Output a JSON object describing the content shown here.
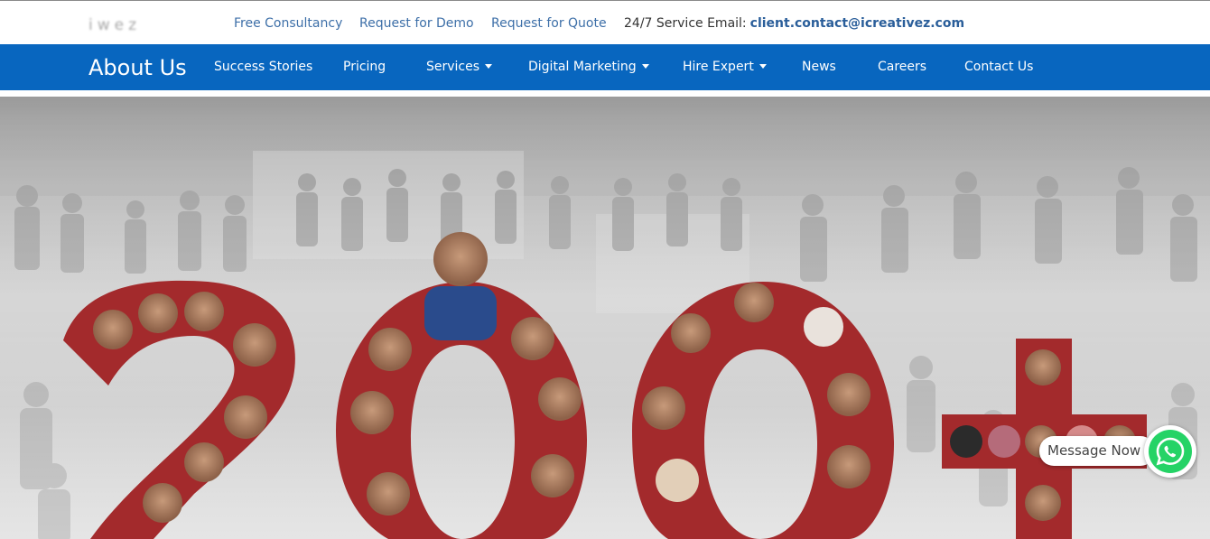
{
  "logo": {
    "text": "iwez"
  },
  "topbar": {
    "links": [
      "Free Consultancy",
      "Request for Demo",
      "Request for Quote"
    ],
    "service_label": "24/7 Service Email:",
    "service_email": "client.contact@icreativez.com"
  },
  "navbar": {
    "brand": "About Us",
    "items": [
      {
        "label": "Success Stories",
        "dropdown": false
      },
      {
        "label": "Pricing",
        "dropdown": false
      },
      {
        "label": "Services",
        "dropdown": true
      },
      {
        "label": "Digital Marketing",
        "dropdown": true
      },
      {
        "label": "Hire Expert",
        "dropdown": true
      },
      {
        "label": "News",
        "dropdown": false
      },
      {
        "label": "Careers",
        "dropdown": false
      },
      {
        "label": "Contact Us",
        "dropdown": false
      }
    ],
    "background": "#0866bf"
  },
  "hero": {
    "description_icon": "team-photo-collage",
    "big_number": "200+",
    "accent": "#a32a2c"
  },
  "chat_widget": {
    "label": "Message Now",
    "icon": "whatsapp-icon",
    "color": "#25d366"
  }
}
